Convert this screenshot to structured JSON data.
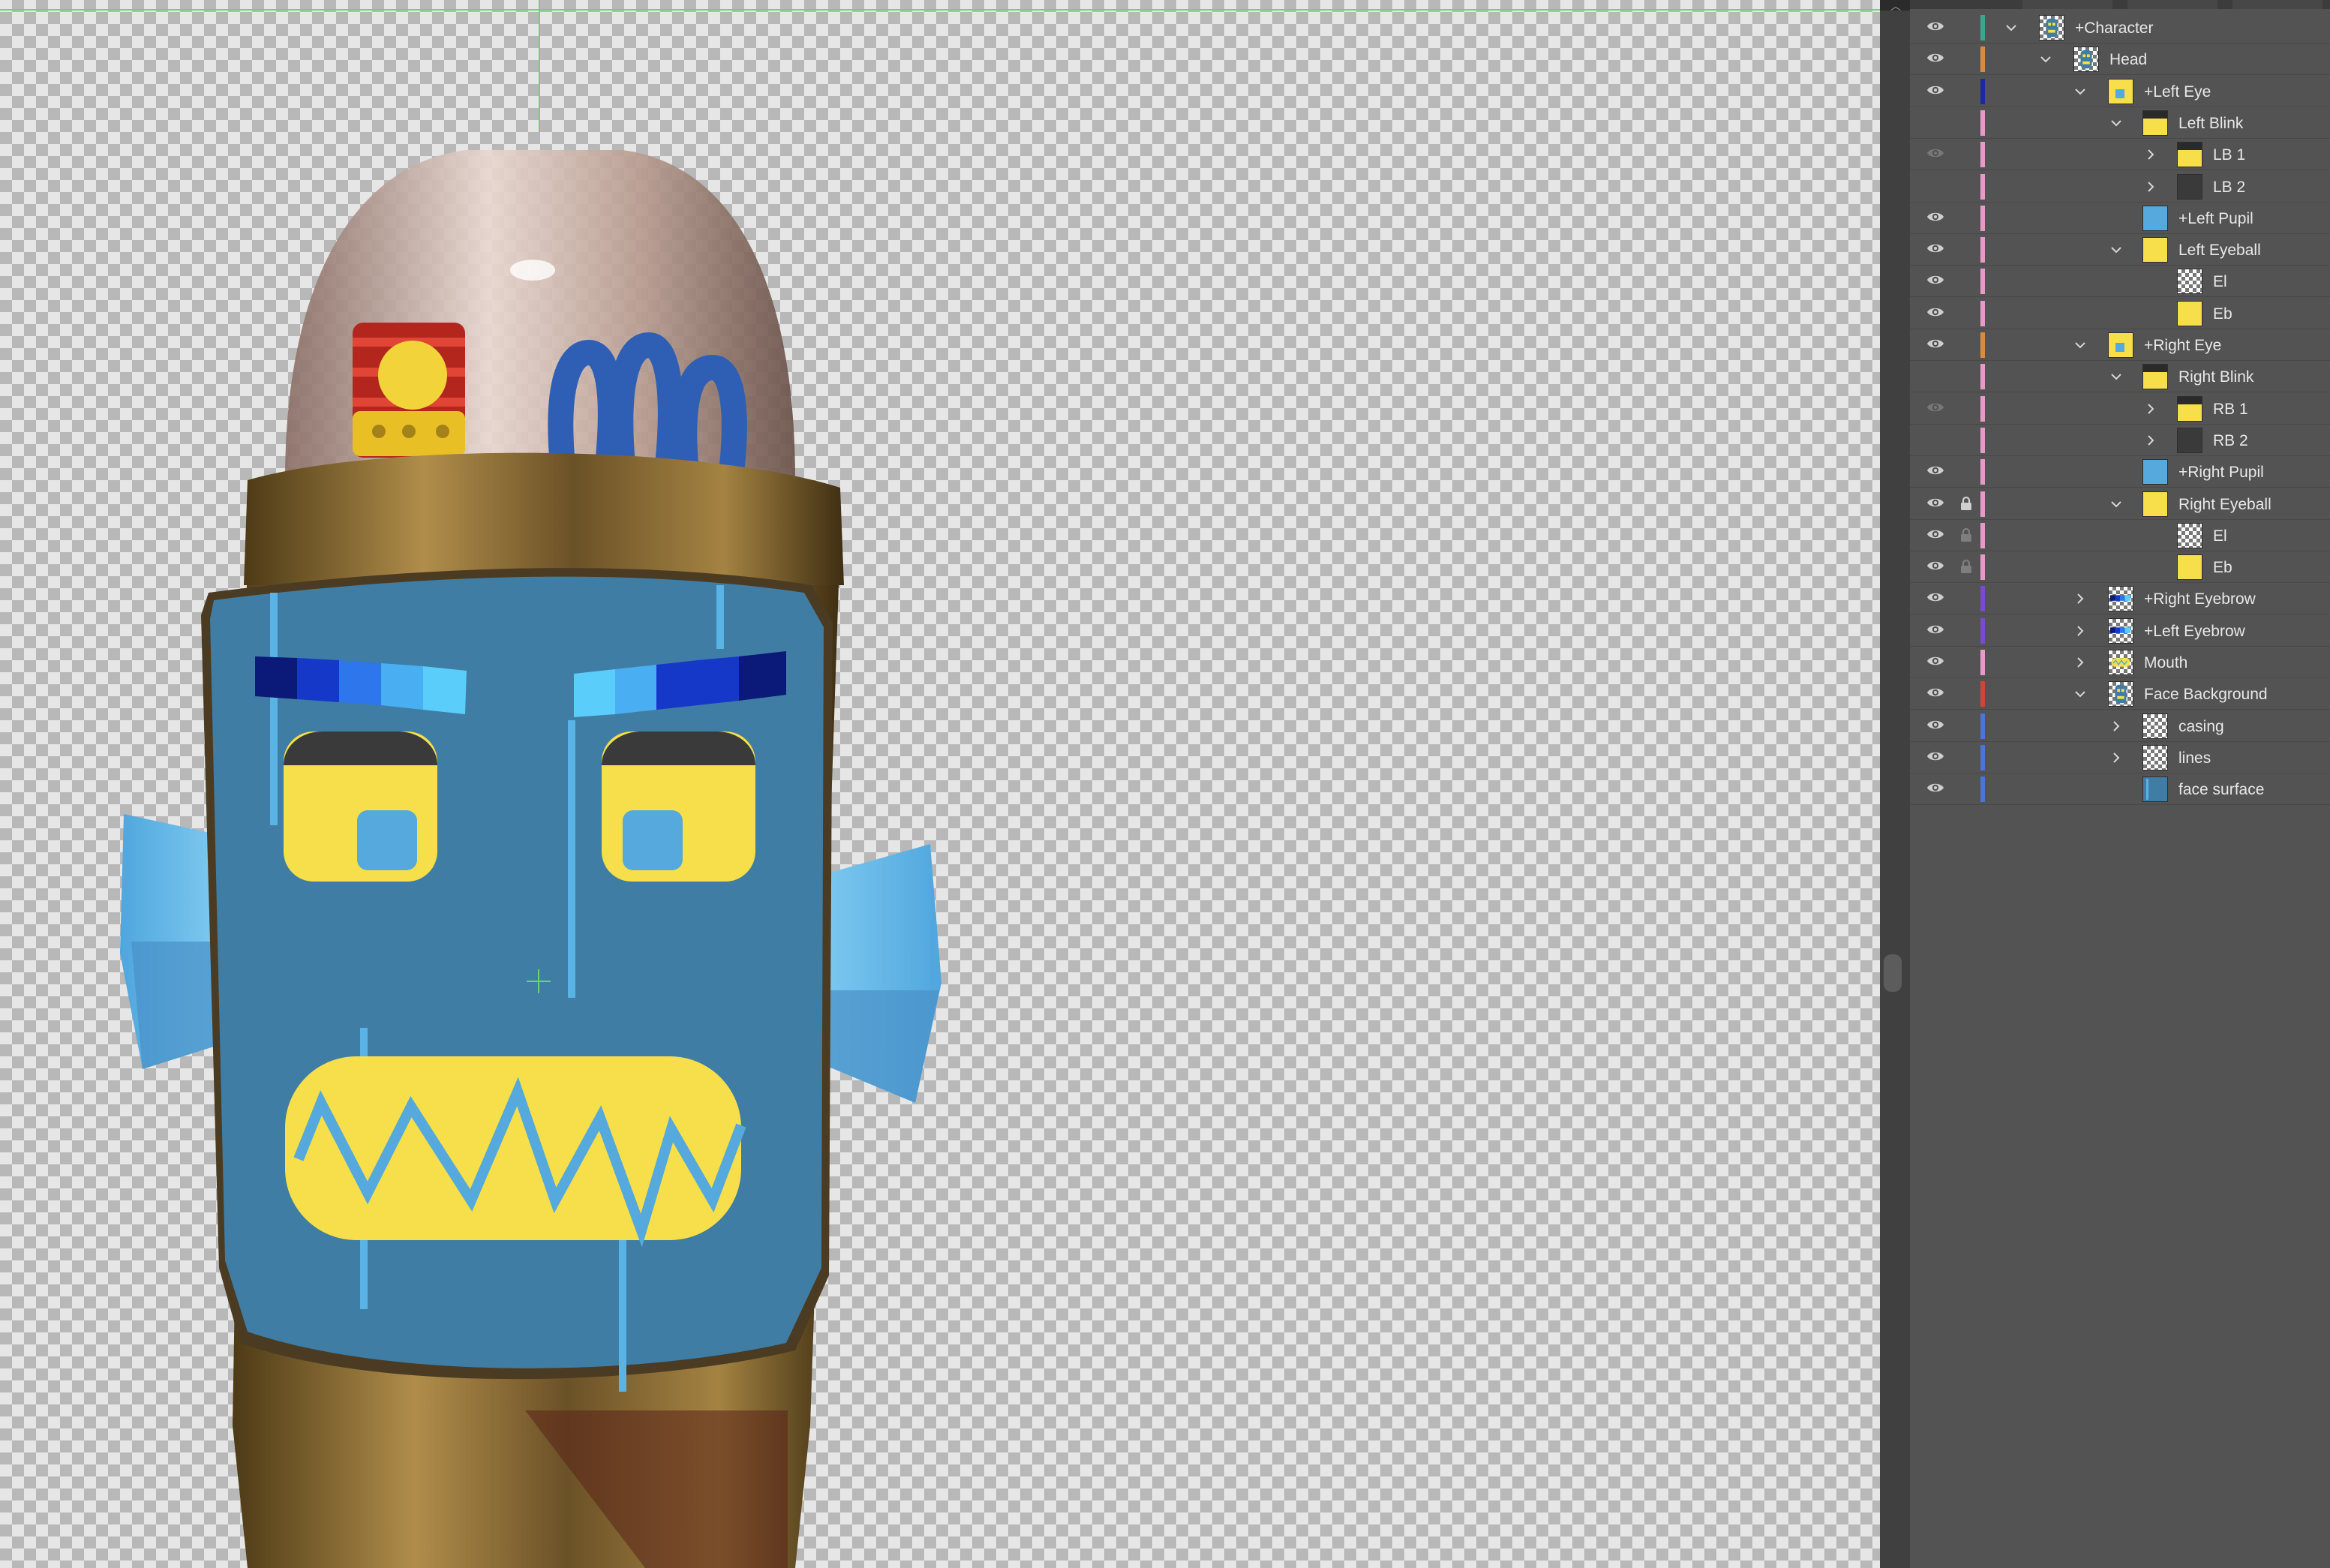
{
  "layers": [
    {
      "name": "+Character",
      "depth": 0,
      "expander": "open",
      "eye": "on",
      "lock": "none",
      "color": "#3aa68f",
      "thumb": "art"
    },
    {
      "name": "Head",
      "depth": 1,
      "expander": "open",
      "eye": "on",
      "lock": "none",
      "color": "#d88c43",
      "thumb": "art"
    },
    {
      "name": "+Left Eye",
      "depth": 2,
      "expander": "open",
      "eye": "on",
      "lock": "none",
      "color": "#1c2aa0",
      "thumb": "yellow-blue"
    },
    {
      "name": "Left Blink",
      "depth": 3,
      "expander": "open",
      "eye": "off",
      "lock": "none",
      "color": "#e59ac8",
      "thumb": "yellow-dark"
    },
    {
      "name": "LB 1",
      "depth": 4,
      "expander": "closed",
      "eye": "dim",
      "lock": "none",
      "color": "#e59ac8",
      "thumb": "yellow-dark"
    },
    {
      "name": "LB 2",
      "depth": 4,
      "expander": "closed",
      "eye": "off",
      "lock": "none",
      "color": "#e59ac8",
      "thumb": "dark"
    },
    {
      "name": "+Left Pupil",
      "depth": 3,
      "expander": "none",
      "eye": "on",
      "lock": "none",
      "color": "#e59ac8",
      "thumb": "blue"
    },
    {
      "name": "Left Eyeball",
      "depth": 3,
      "expander": "open",
      "eye": "on",
      "lock": "none",
      "color": "#e59ac8",
      "thumb": "yellow"
    },
    {
      "name": "El",
      "depth": 4,
      "expander": "none",
      "eye": "on",
      "lock": "none",
      "color": "#e59ac8",
      "thumb": "checker"
    },
    {
      "name": "Eb",
      "depth": 4,
      "expander": "none",
      "eye": "on",
      "lock": "none",
      "color": "#e59ac8",
      "thumb": "yellow"
    },
    {
      "name": "+Right Eye",
      "depth": 2,
      "expander": "open",
      "eye": "on",
      "lock": "none",
      "color": "#d88c43",
      "thumb": "yellow-blue"
    },
    {
      "name": "Right Blink",
      "depth": 3,
      "expander": "open",
      "eye": "off",
      "lock": "none",
      "color": "#e59ac8",
      "thumb": "yellow-dark"
    },
    {
      "name": "RB 1",
      "depth": 4,
      "expander": "closed",
      "eye": "dim",
      "lock": "none",
      "color": "#e59ac8",
      "thumb": "yellow-dark"
    },
    {
      "name": "RB 2",
      "depth": 4,
      "expander": "closed",
      "eye": "off",
      "lock": "none",
      "color": "#e59ac8",
      "thumb": "dark"
    },
    {
      "name": "+Right Pupil",
      "depth": 3,
      "expander": "none",
      "eye": "on",
      "lock": "none",
      "color": "#e59ac8",
      "thumb": "blue"
    },
    {
      "name": "Right Eyeball",
      "depth": 3,
      "expander": "open",
      "eye": "on",
      "lock": "on",
      "color": "#e59ac8",
      "thumb": "yellow"
    },
    {
      "name": "El",
      "depth": 4,
      "expander": "none",
      "eye": "on",
      "lock": "dim",
      "color": "#e59ac8",
      "thumb": "checker"
    },
    {
      "name": "Eb",
      "depth": 4,
      "expander": "none",
      "eye": "on",
      "lock": "dim",
      "color": "#e59ac8",
      "thumb": "yellow"
    },
    {
      "name": "+Right Eyebrow",
      "depth": 2,
      "expander": "closed",
      "eye": "on",
      "lock": "none",
      "color": "#7a4ad0",
      "thumb": "brow"
    },
    {
      "name": "+Left Eyebrow",
      "depth": 2,
      "expander": "closed",
      "eye": "on",
      "lock": "none",
      "color": "#7a4ad0",
      "thumb": "brow"
    },
    {
      "name": "Mouth",
      "depth": 2,
      "expander": "closed",
      "eye": "on",
      "lock": "none",
      "color": "#e59ac8",
      "thumb": "mouth"
    },
    {
      "name": "Face Background",
      "depth": 2,
      "expander": "open",
      "eye": "on",
      "lock": "none",
      "color": "#d0453a",
      "thumb": "art"
    },
    {
      "name": "casing",
      "depth": 3,
      "expander": "closed",
      "eye": "on",
      "lock": "none",
      "color": "#4a74d8",
      "thumb": "checker"
    },
    {
      "name": "lines",
      "depth": 3,
      "expander": "closed",
      "eye": "on",
      "lock": "none",
      "color": "#4a74d8",
      "thumb": "checker"
    },
    {
      "name": "face surface",
      "depth": 3,
      "expander": "none",
      "eye": "on",
      "lock": "none",
      "color": "#4a74d8",
      "thumb": "face"
    }
  ],
  "colors": {
    "face": "#3f7da4",
    "face_line": "#59b3e4",
    "eye_yellow": "#f6df4a",
    "eye_lid": "#3a3a3a",
    "pupil": "#56a9dc",
    "ear": "#5bb4e8",
    "brow": [
      "#0b1a78",
      "#1638c9",
      "#2d76ec",
      "#4aaef2",
      "#5bcdfa"
    ],
    "gold": "#8c6a2f",
    "panel_bg": "#535353",
    "guide": "#63d86b"
  }
}
